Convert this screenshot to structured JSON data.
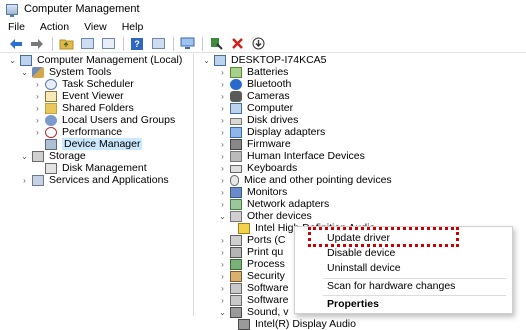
{
  "window": {
    "title": "Computer Management"
  },
  "menu": [
    "File",
    "Action",
    "View",
    "Help"
  ],
  "toolbar_icons": [
    "back-icon",
    "forward-icon",
    "up-folder-icon",
    "show-hide-tree-icon",
    "properties-icon",
    "help-icon",
    "action-pane-icon",
    "monitor-icon",
    "enable-device-icon",
    "uninstall-icon",
    "update-driver-icon"
  ],
  "left_tree": [
    {
      "label": "Computer Management (Local)",
      "level": 0,
      "expander": "v",
      "icon": "computer"
    },
    {
      "label": "System Tools",
      "level": 1,
      "expander": "v",
      "icon": "tools"
    },
    {
      "label": "Task Scheduler",
      "level": 2,
      "expander": ">",
      "icon": "clock"
    },
    {
      "label": "Event Viewer",
      "level": 2,
      "expander": ">",
      "icon": "event"
    },
    {
      "label": "Shared Folders",
      "level": 2,
      "expander": ">",
      "icon": "folder"
    },
    {
      "label": "Local Users and Groups",
      "level": 2,
      "expander": ">",
      "icon": "users"
    },
    {
      "label": "Performance",
      "level": 2,
      "expander": ">",
      "icon": "perf"
    },
    {
      "label": "Device Manager",
      "level": 2,
      "expander": "",
      "icon": "device",
      "selected": true
    },
    {
      "label": "Storage",
      "level": 1,
      "expander": "v",
      "icon": "storage"
    },
    {
      "label": "Disk Management",
      "level": 2,
      "expander": "",
      "icon": "disk"
    },
    {
      "label": "Services and Applications",
      "level": 1,
      "expander": ">",
      "icon": "services"
    }
  ],
  "right_tree": [
    {
      "label": "DESKTOP-I74KCA5",
      "level": 0,
      "expander": "v",
      "icon": "computer"
    },
    {
      "label": "Batteries",
      "level": 1,
      "expander": ">",
      "icon": "battery"
    },
    {
      "label": "Bluetooth",
      "level": 1,
      "expander": ">",
      "icon": "bt"
    },
    {
      "label": "Cameras",
      "level": 1,
      "expander": ">",
      "icon": "camera"
    },
    {
      "label": "Computer",
      "level": 1,
      "expander": ">",
      "icon": "computer"
    },
    {
      "label": "Disk drives",
      "level": 1,
      "expander": ">",
      "icon": "drive"
    },
    {
      "label": "Display adapters",
      "level": 1,
      "expander": ">",
      "icon": "display"
    },
    {
      "label": "Firmware",
      "level": 1,
      "expander": ">",
      "icon": "chip"
    },
    {
      "label": "Human Interface Devices",
      "level": 1,
      "expander": ">",
      "icon": "hid"
    },
    {
      "label": "Keyboards",
      "level": 1,
      "expander": ">",
      "icon": "keyboard"
    },
    {
      "label": "Mice and other pointing devices",
      "level": 1,
      "expander": ">",
      "icon": "mouse"
    },
    {
      "label": "Monitors",
      "level": 1,
      "expander": ">",
      "icon": "monitor"
    },
    {
      "label": "Network adapters",
      "level": 1,
      "expander": ">",
      "icon": "network"
    },
    {
      "label": "Other devices",
      "level": 1,
      "expander": "v",
      "icon": "other"
    },
    {
      "label": "Intel High Definition Audio",
      "level": 2,
      "expander": "",
      "icon": "warn"
    },
    {
      "label": "Ports (C",
      "level": 1,
      "expander": ">",
      "icon": "port"
    },
    {
      "label": "Print qu",
      "level": 1,
      "expander": ">",
      "icon": "printer"
    },
    {
      "label": "Process",
      "level": 1,
      "expander": ">",
      "icon": "cpu"
    },
    {
      "label": "Security",
      "level": 1,
      "expander": ">",
      "icon": "security"
    },
    {
      "label": "Software",
      "level": 1,
      "expander": ">",
      "icon": "software"
    },
    {
      "label": "Software",
      "level": 1,
      "expander": ">",
      "icon": "software"
    },
    {
      "label": "Sound, v",
      "level": 1,
      "expander": "v",
      "icon": "sound"
    },
    {
      "label": "Intel(R) Display Audio",
      "level": 2,
      "expander": "",
      "icon": "sound"
    }
  ],
  "context_menu": {
    "items": [
      {
        "label": "Update driver",
        "bold": false
      },
      {
        "label": "Disable device",
        "bold": false
      },
      {
        "label": "Uninstall device",
        "bold": false
      },
      {
        "label": "Scan for hardware changes",
        "bold": false
      },
      {
        "label": "Properties",
        "bold": true
      }
    ]
  },
  "colors": {
    "highlight": "#cc0000",
    "selection": "#cce8ff"
  }
}
